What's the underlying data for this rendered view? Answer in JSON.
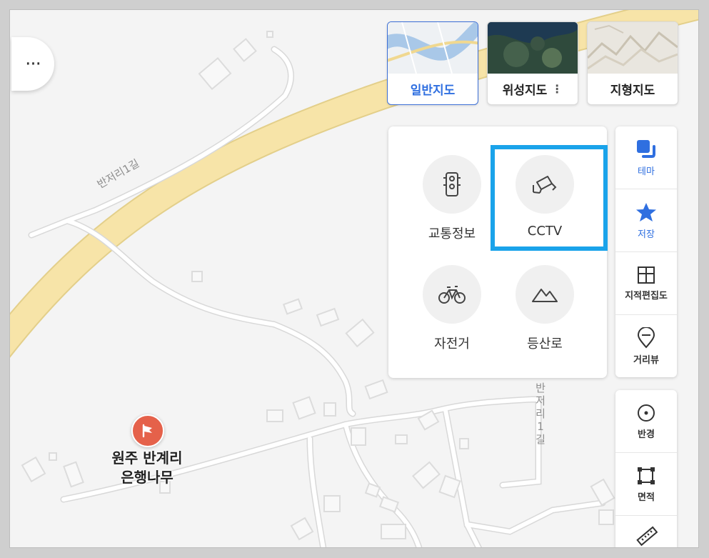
{
  "map": {
    "road_label_upper": "반저리1길",
    "road_label_lower": "반저리1길",
    "more_button": "···"
  },
  "poi": {
    "name_line1": "원주 반계리",
    "name_line2": "은행나무",
    "pin_color": "#e5614a"
  },
  "map_types": [
    {
      "label": "일반지도",
      "active": true
    },
    {
      "label": "위성지도",
      "menu": "⋮"
    },
    {
      "label": "지형지도"
    }
  ],
  "layers": [
    {
      "label": "교통정보",
      "icon": "traffic-light-icon"
    },
    {
      "label": "CCTV",
      "icon": "cctv-icon"
    },
    {
      "label": "자전거",
      "icon": "bicycle-icon"
    },
    {
      "label": "등산로",
      "icon": "mountain-icon"
    }
  ],
  "side_tools": [
    {
      "label": "테마",
      "icon": "layers-icon"
    },
    {
      "label": "저장",
      "icon": "star-icon"
    },
    {
      "label": "지적편집도",
      "icon": "grid-icon"
    },
    {
      "label": "거리뷰",
      "icon": "streetview-icon"
    }
  ],
  "measure_tools": [
    {
      "label": "반경",
      "icon": "radius-icon"
    },
    {
      "label": "면적",
      "icon": "area-icon"
    },
    {
      "label": "",
      "icon": "ruler-icon"
    }
  ],
  "colors": {
    "accent_blue": "#2f6fe0",
    "highlight": "#1aa3ea",
    "main_road": "#f7e4a8"
  }
}
